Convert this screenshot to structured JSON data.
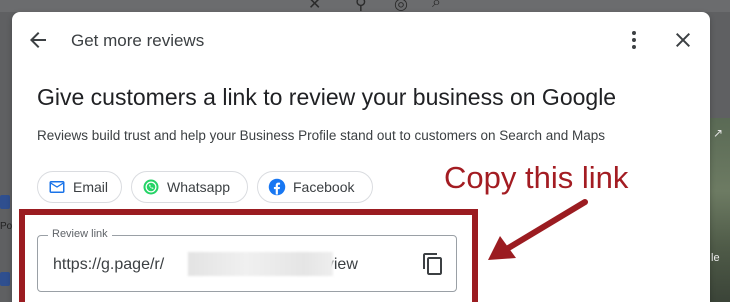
{
  "dialog": {
    "header_title": "Get more reviews",
    "title": "Give customers a link to review your business on Google",
    "subtitle": "Reviews build trust and help your Business Profile stand out to customers on Search and Maps",
    "share_options": [
      {
        "label": "Email",
        "icon": "mail-icon"
      },
      {
        "label": "Whatsapp",
        "icon": "whatsapp-icon"
      },
      {
        "label": "Facebook",
        "icon": "facebook-icon"
      }
    ],
    "review_link": {
      "label": "Review link",
      "prefix": "https://g.page/r/",
      "suffix": "/review"
    }
  },
  "background": {
    "left_text": "Po",
    "right_text": "le"
  },
  "annotation": {
    "text": "Copy this link",
    "color": "#a31c22"
  },
  "colors": {
    "accent": "#1a73e8",
    "whatsapp": "#25d366",
    "facebook": "#1877f2",
    "highlight": "#9b1c21"
  }
}
